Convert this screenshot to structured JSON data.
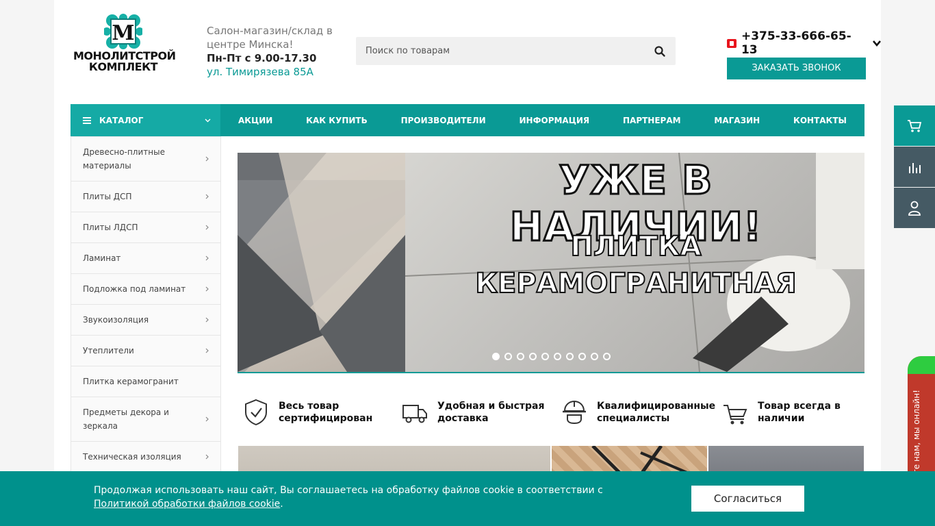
{
  "brand": {
    "logo_line1": "МОНОЛИТСТРОЙ",
    "logo_line2": "КОМПЛЕКТ",
    "emblem_letter": "M"
  },
  "header": {
    "info_line1": "Салон-магазин/склад в центре Минска!",
    "hours": "Пн-Пт с 9.00-17.30",
    "address": "ул. Тимирязева 85А",
    "search_placeholder": "Поиск по товарам",
    "phone": "+375-33-666-65-13",
    "callback_label": "ЗАКАЗАТЬ ЗВОНОК"
  },
  "nav": {
    "catalog_label": "КАТАЛОГ",
    "items": [
      "АКЦИИ",
      "КАК КУПИТЬ",
      "ПРОИЗВОДИТЕЛИ",
      "ИНФОРМАЦИЯ",
      "ПАРТНЕРАМ",
      "МАГАЗИН",
      "КОНТАКТЫ"
    ]
  },
  "sidebar": {
    "items": [
      {
        "label": "Древесно-плитные материалы",
        "has_arrow": true
      },
      {
        "label": "Плиты ДСП",
        "has_arrow": true
      },
      {
        "label": "Плиты ЛДСП",
        "has_arrow": true
      },
      {
        "label": "Ламинат",
        "has_arrow": true
      },
      {
        "label": "Подложка под ламинат",
        "has_arrow": true
      },
      {
        "label": "Звукоизоляция",
        "has_arrow": true
      },
      {
        "label": "Утеплители",
        "has_arrow": true
      },
      {
        "label": "Плитка керамогранит",
        "has_arrow": false
      },
      {
        "label": "Предметы декора и зеркала",
        "has_arrow": true
      },
      {
        "label": "Техническая изоляция",
        "has_arrow": true
      }
    ]
  },
  "banner": {
    "headline": "УЖЕ В НАЛИЧИИ!",
    "subline1": "ПЛИТКА",
    "subline2": "КЕРАМОГРАНИТНАЯ",
    "slide_count": 10,
    "active_slide": 1
  },
  "features": [
    {
      "icon": "certified-shield-icon",
      "text": "Весь товар сертифицирован"
    },
    {
      "icon": "delivery-truck-icon",
      "text": "Удобная и быстрая доставка"
    },
    {
      "icon": "hardhat-worker-icon",
      "text": "Квалифицированные специалисты"
    },
    {
      "icon": "shopping-cart-icon",
      "text": "Товар всегда в наличии"
    }
  ],
  "right_toolbar": [
    {
      "icon": "cart-icon"
    },
    {
      "icon": "compare-chart-icon"
    },
    {
      "icon": "user-icon"
    }
  ],
  "chat": {
    "label": "ите нам, мы онлайн!"
  },
  "cookie": {
    "text": "Продолжая использовать наш сайт, Вы соглашаетесь на обработку файлов cookie в соответствии с",
    "link": "Политикой обработки файлов cookie",
    "suffix": ".",
    "agree_label": "Согласиться"
  },
  "colors": {
    "accent": "#0a9a95",
    "accent_light": "#15aaa5",
    "cookie_bg": "#00918c",
    "toolbar_cart": "#0a9a95",
    "toolbar_dark": "#455a64"
  }
}
